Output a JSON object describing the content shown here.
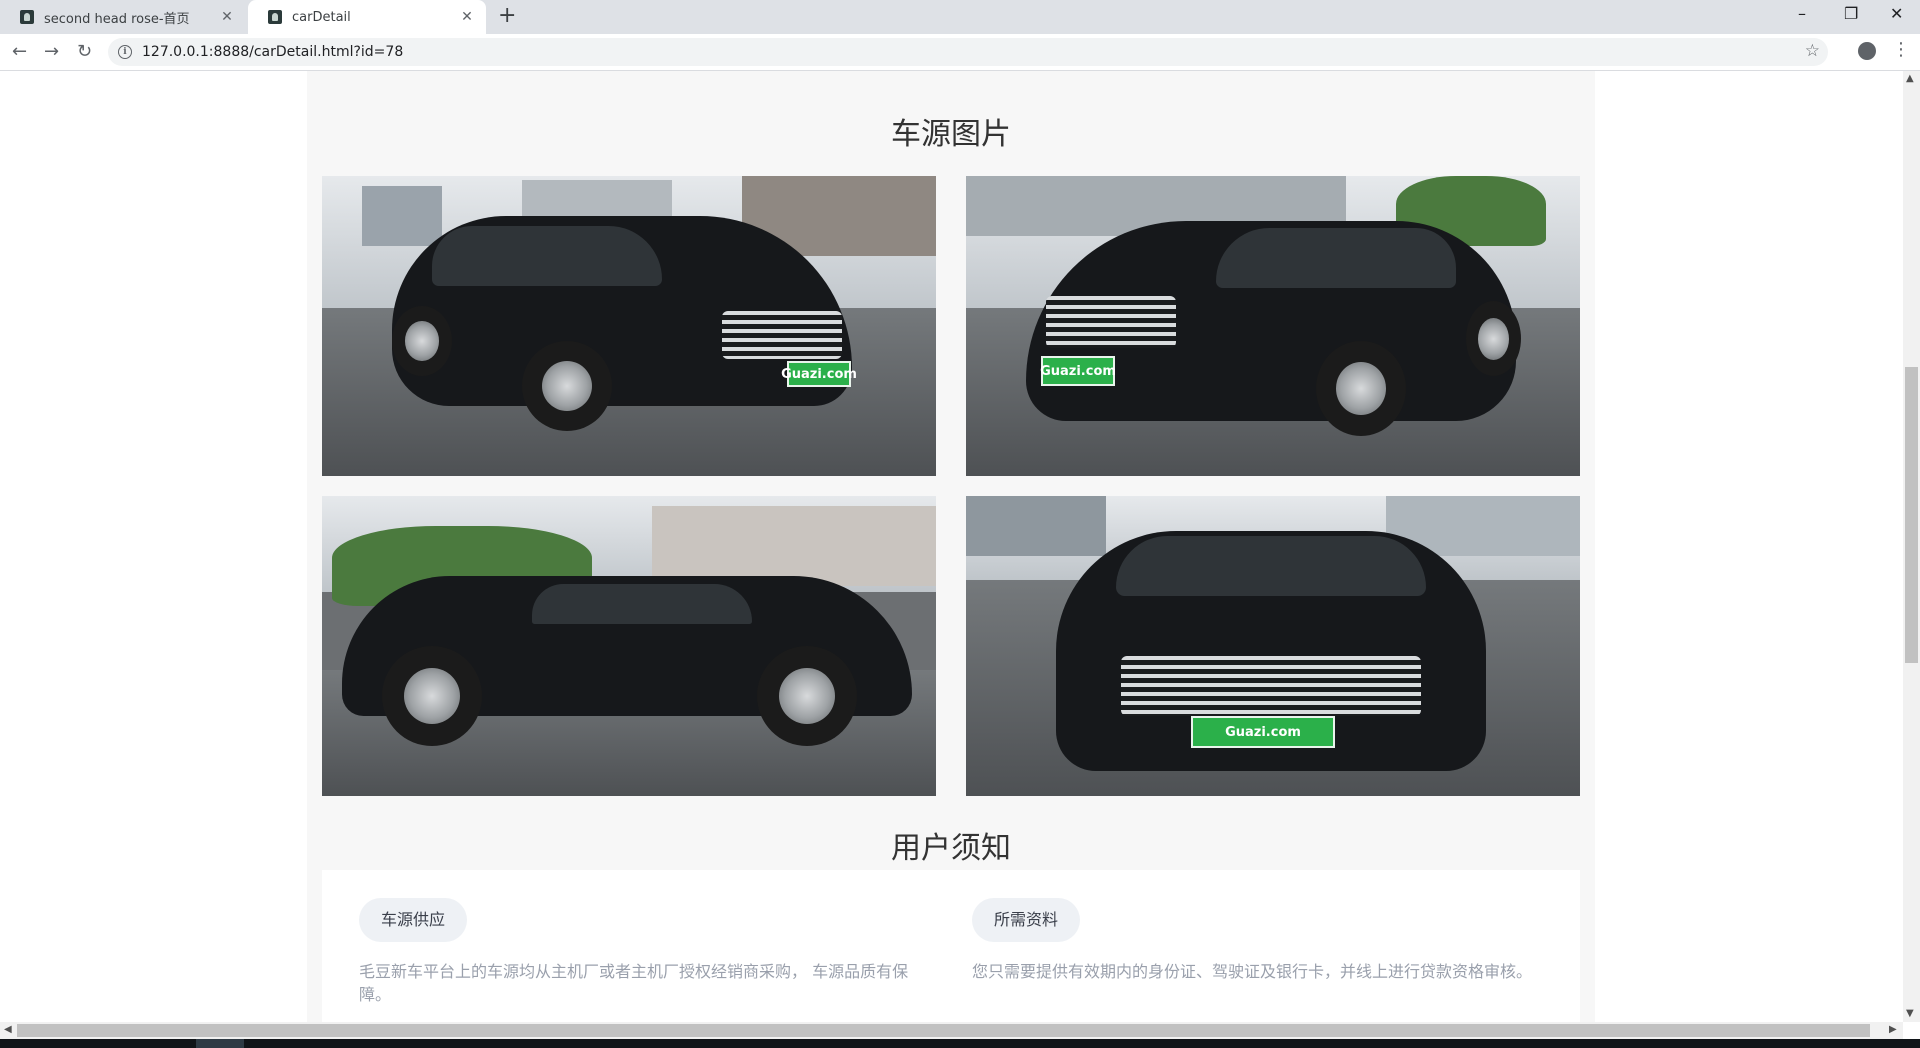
{
  "browser": {
    "tabs": [
      {
        "title": "second head rose-首页",
        "close": "✕"
      },
      {
        "title": "carDetail",
        "close": "✕"
      }
    ],
    "new_tab": "+",
    "url": "127.0.0.1:8888/carDetail.html?id=78",
    "window_controls": {
      "minimize": "–",
      "restore": "❐",
      "close": "✕"
    }
  },
  "page": {
    "photos_title": "车源图片",
    "photos": [
      {
        "icon": "car-front-left-photo"
      },
      {
        "icon": "car-front-right-photo"
      },
      {
        "icon": "car-side-photo"
      },
      {
        "icon": "car-front-photo"
      }
    ],
    "plate_text": "Guazi.com",
    "notice_title": "用户须知",
    "notices": [
      {
        "label": "车源供应",
        "text": "毛豆新车平台上的车源均从主机厂或者主机厂授权经销商采购， 车源品质有保障。"
      },
      {
        "label": "所需资料",
        "text": "您只需要提供有效期内的身份证、驾驶证及银行卡，并线上进行贷款资格审核。"
      }
    ]
  },
  "colors": {
    "page_bg": "#f7f7f7",
    "pill_bg": "#eef1f5",
    "notice_text": "#9aa0ac"
  }
}
